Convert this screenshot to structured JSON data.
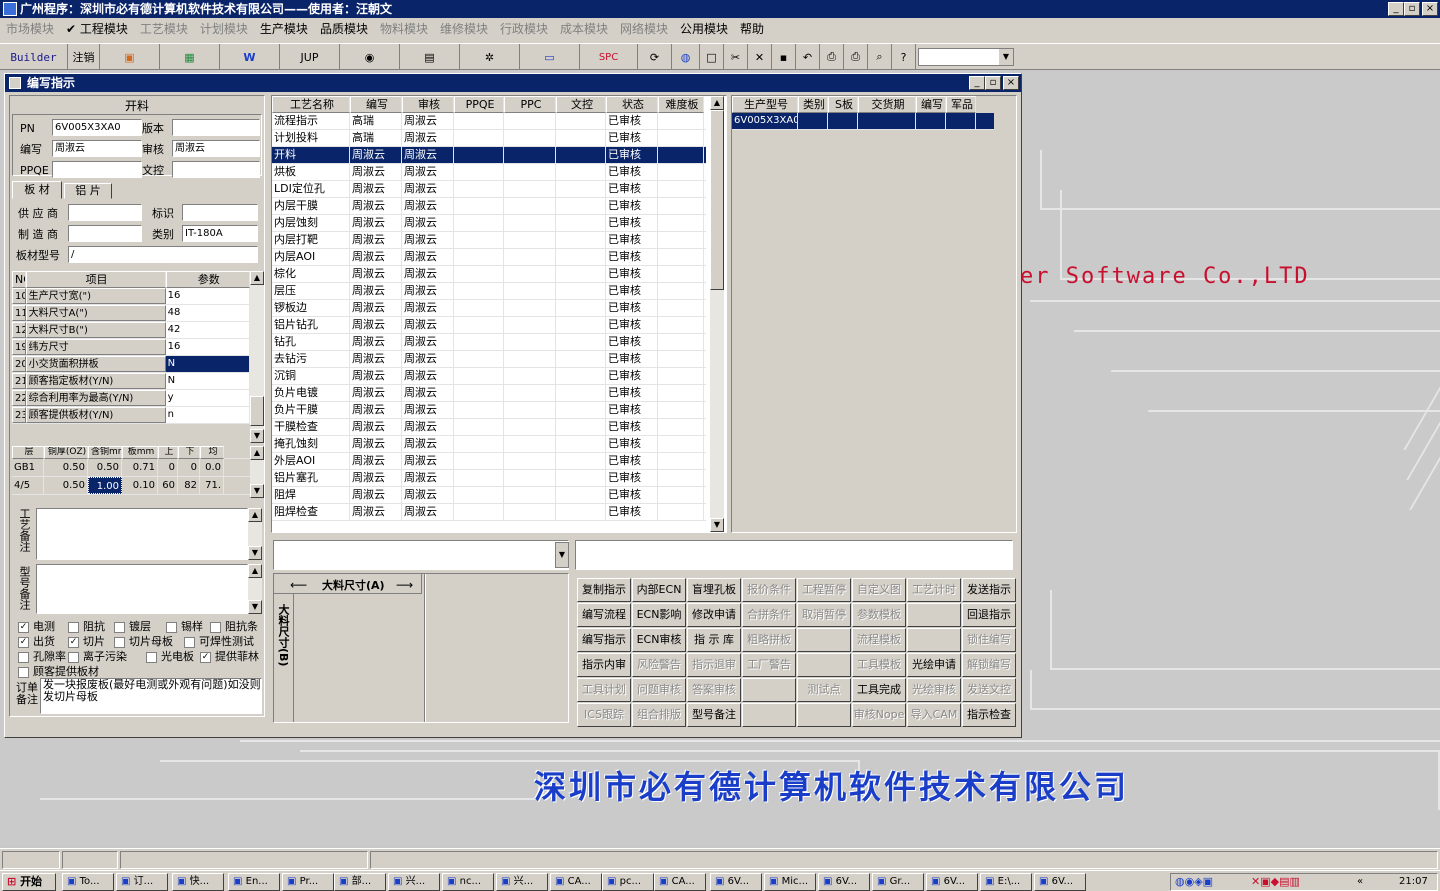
{
  "app": {
    "title": "广州程序：深圳市必有德计算机软件技术有限公司——使用者：汪朝文",
    "min": "_",
    "max": "▫",
    "close": "×"
  },
  "menu": [
    {
      "label": "市场模块",
      "dis": true
    },
    {
      "label": "✔ 工程模块",
      "dis": false
    },
    {
      "label": "工艺模块",
      "dis": true
    },
    {
      "label": "计划模块",
      "dis": true
    },
    {
      "label": "生产模块",
      "dis": false
    },
    {
      "label": "品质模块",
      "dis": false
    },
    {
      "label": "物料模块",
      "dis": true
    },
    {
      "label": "维修模块",
      "dis": true
    },
    {
      "label": "行政模块",
      "dis": true
    },
    {
      "label": "成本模块",
      "dis": true
    },
    {
      "label": "网络模块",
      "dis": true
    },
    {
      "label": "公用模块",
      "dis": false
    },
    {
      "label": "帮助",
      "dis": false
    }
  ],
  "toolbar": {
    "builder": "Builder",
    "logout": "注销",
    "jup": "JUP",
    "spc": "SPC",
    "combo": ""
  },
  "background": {
    "watermark": "er Software Co.,LTD",
    "company": "深圳市必有德计算机软件技术有限公司"
  },
  "window": {
    "title": "编写指示"
  },
  "left": {
    "section": "开料",
    "pn_label": "PN",
    "pn": "6V005X3XA0",
    "version_label": "版本",
    "version": "",
    "author_label": "编写",
    "author": "周淑云",
    "review_label": "审核",
    "review": "周淑云",
    "ppqe_label": "PPQE",
    "ppqe": "",
    "doc_label": "文控",
    "doc": "",
    "tab1": "板 材",
    "tab2": "铝 片",
    "supplier_label": "供 应 商",
    "supplier": "",
    "mark_label": "标识",
    "mark": "",
    "maker_label": "制 造 商",
    "maker": "",
    "category_label": "类别",
    "category": "IT-180A",
    "model_label": "板材型号",
    "model": "/",
    "params_headers": [
      "NO",
      "项目",
      "参数"
    ],
    "params": [
      {
        "no": "10",
        "item": "生产尺寸宽(\")",
        "val": "16"
      },
      {
        "no": "11",
        "item": "大料尺寸A(\")",
        "val": "48"
      },
      {
        "no": "12",
        "item": "大料尺寸B(\")",
        "val": "42"
      },
      {
        "no": "19",
        "item": "纬方尺寸",
        "val": "16"
      },
      {
        "no": "20",
        "item": "小交货面积拼板",
        "val": "N"
      },
      {
        "no": "21",
        "item": "顾客指定板材(Y/N)",
        "val": "N"
      },
      {
        "no": "22",
        "item": "综合利用率为最高(Y/N)",
        "val": "y"
      },
      {
        "no": "23",
        "item": "顾客提供板材(Y/N)",
        "val": "n"
      }
    ],
    "layer_headers": [
      "层",
      "铜厚(OZ)",
      "含铜mm",
      "板mm",
      "上",
      "下",
      "均"
    ],
    "layers": [
      {
        "l": "GB1",
        "a": "0.50",
        "b": "0.50",
        "c": "0.71",
        "d": "0",
        "e": "0",
        "f": "0.0"
      },
      {
        "l": "4/5",
        "a": "0.50",
        "b": "1.00",
        "c": "0.10",
        "d": "60",
        "e": "82",
        "f": "71."
      }
    ],
    "process_note_label": "工艺备注",
    "model_note_label": "型号备注",
    "checks": [
      {
        "label": "电测",
        "on": true
      },
      {
        "label": "阻抗",
        "on": false
      },
      {
        "label": "镀层",
        "on": false
      },
      {
        "label": "锡样",
        "on": false
      },
      {
        "label": "阻抗条",
        "on": false
      },
      {
        "label": "出货",
        "on": true
      },
      {
        "label": "切片",
        "on": true
      },
      {
        "label": "切片母板",
        "on": false
      },
      {
        "label": "可焊性测试",
        "on": false
      },
      {
        "label": "孔隙率",
        "on": false
      },
      {
        "label": "离子污染",
        "on": false
      },
      {
        "label": "光电板",
        "on": false
      },
      {
        "label": "提供菲林",
        "on": true
      },
      {
        "label": "顾客提供板材",
        "on": false
      }
    ],
    "order_note_label": "订单备注",
    "order_note": "发一块报废板(最好电测或外观有问题)如没则发切片母板"
  },
  "process": {
    "headers": [
      "工艺名称",
      "编写",
      "审核",
      "PPQE",
      "PPC",
      "文控",
      "状态",
      "难度板"
    ],
    "rows": [
      [
        "流程指示",
        "高瑞",
        "周淑云",
        "",
        "",
        "",
        "已审核",
        ""
      ],
      [
        "计划投料",
        "高瑞",
        "周淑云",
        "",
        "",
        "",
        "已审核",
        ""
      ],
      [
        "开料",
        "周淑云",
        "周淑云",
        "",
        "",
        "",
        "已审核",
        ""
      ],
      [
        "烘板",
        "周淑云",
        "周淑云",
        "",
        "",
        "",
        "已审核",
        ""
      ],
      [
        "LDI定位孔",
        "周淑云",
        "周淑云",
        "",
        "",
        "",
        "已审核",
        ""
      ],
      [
        "内层干膜",
        "周淑云",
        "周淑云",
        "",
        "",
        "",
        "已审核",
        ""
      ],
      [
        "内层蚀刻",
        "周淑云",
        "周淑云",
        "",
        "",
        "",
        "已审核",
        ""
      ],
      [
        "内层打靶",
        "周淑云",
        "周淑云",
        "",
        "",
        "",
        "已审核",
        ""
      ],
      [
        "内层AOI",
        "周淑云",
        "周淑云",
        "",
        "",
        "",
        "已审核",
        ""
      ],
      [
        "棕化",
        "周淑云",
        "周淑云",
        "",
        "",
        "",
        "已审核",
        ""
      ],
      [
        "层压",
        "周淑云",
        "周淑云",
        "",
        "",
        "",
        "已审核",
        ""
      ],
      [
        "锣板边",
        "周淑云",
        "周淑云",
        "",
        "",
        "",
        "已审核",
        ""
      ],
      [
        "铝片钻孔",
        "周淑云",
        "周淑云",
        "",
        "",
        "",
        "已审核",
        ""
      ],
      [
        "钻孔",
        "周淑云",
        "周淑云",
        "",
        "",
        "",
        "已审核",
        ""
      ],
      [
        "去钻污",
        "周淑云",
        "周淑云",
        "",
        "",
        "",
        "已审核",
        ""
      ],
      [
        "沉铜",
        "周淑云",
        "周淑云",
        "",
        "",
        "",
        "已审核",
        ""
      ],
      [
        "负片电镀",
        "周淑云",
        "周淑云",
        "",
        "",
        "",
        "已审核",
        ""
      ],
      [
        "负片干膜",
        "周淑云",
        "周淑云",
        "",
        "",
        "",
        "已审核",
        ""
      ],
      [
        "干膜检查",
        "周淑云",
        "周淑云",
        "",
        "",
        "",
        "已审核",
        ""
      ],
      [
        "掩孔蚀刻",
        "周淑云",
        "周淑云",
        "",
        "",
        "",
        "已审核",
        ""
      ],
      [
        "外层AOI",
        "周淑云",
        "周淑云",
        "",
        "",
        "",
        "已审核",
        ""
      ],
      [
        "铝片塞孔",
        "周淑云",
        "周淑云",
        "",
        "",
        "",
        "已审核",
        ""
      ],
      [
        "阻焊",
        "周淑云",
        "周淑云",
        "",
        "",
        "",
        "已审核",
        ""
      ],
      [
        "阻焊检查",
        "周淑云",
        "周淑云",
        "",
        "",
        "",
        "已审核",
        ""
      ]
    ]
  },
  "products": {
    "headers": [
      "生产型号",
      "类别",
      "S板",
      "交货期",
      "编写",
      "军品"
    ],
    "rows": [
      [
        "6V005X3XA0",
        "",
        "",
        "",
        "",
        ""
      ]
    ]
  },
  "dims": {
    "a_label": "大料尺寸(A)",
    "b_label": "大料尺寸(B)"
  },
  "buttons": [
    [
      {
        "t": "复制指示",
        "d": false
      },
      {
        "t": "内部ECN",
        "d": false
      },
      {
        "t": "盲埋孔板",
        "d": false
      },
      {
        "t": "报价条件",
        "d": true
      },
      {
        "t": "工程暂停",
        "d": true
      },
      {
        "t": "自定义图",
        "d": true
      },
      {
        "t": "工艺计时",
        "d": true
      },
      {
        "t": "发送指示",
        "d": false
      }
    ],
    [
      {
        "t": "编写流程",
        "d": false
      },
      {
        "t": "ECN影响",
        "d": false
      },
      {
        "t": "修改申请",
        "d": false
      },
      {
        "t": "合拼条件",
        "d": true
      },
      {
        "t": "取消暂停",
        "d": true
      },
      {
        "t": "参数模板",
        "d": true
      },
      {
        "t": "",
        "d": true
      },
      {
        "t": "回退指示",
        "d": false
      }
    ],
    [
      {
        "t": "编写指示",
        "d": false
      },
      {
        "t": "ECN审核",
        "d": false
      },
      {
        "t": "指 示 库",
        "d": false
      },
      {
        "t": "粗略拼板",
        "d": true
      },
      {
        "t": "",
        "d": true
      },
      {
        "t": "流程模板",
        "d": true
      },
      {
        "t": "",
        "d": true
      },
      {
        "t": "锁住编写",
        "d": true
      }
    ],
    [
      {
        "t": "指示内审",
        "d": false
      },
      {
        "t": "风险警告",
        "d": true
      },
      {
        "t": "指示退审",
        "d": true
      },
      {
        "t": "工厂警告",
        "d": true
      },
      {
        "t": "",
        "d": true
      },
      {
        "t": "工具模板",
        "d": true
      },
      {
        "t": "光绘申请",
        "d": false
      },
      {
        "t": "解锁编写",
        "d": true
      }
    ],
    [
      {
        "t": "工具计划",
        "d": true
      },
      {
        "t": "问题审核",
        "d": true
      },
      {
        "t": "答案审核",
        "d": true
      },
      {
        "t": "",
        "d": true
      },
      {
        "t": "测试点",
        "d": true
      },
      {
        "t": "工具完成",
        "d": false
      },
      {
        "t": "光绘审核",
        "d": true
      },
      {
        "t": "发送文控",
        "d": true
      }
    ],
    [
      {
        "t": "ICS跟踪",
        "d": true
      },
      {
        "t": "组合排版",
        "d": true
      },
      {
        "t": "型号备注",
        "d": false
      },
      {
        "t": "",
        "d": true
      },
      {
        "t": "",
        "d": true
      },
      {
        "t": "审核Nope",
        "d": true
      },
      {
        "t": "导入CAM",
        "d": true
      },
      {
        "t": "指示检查",
        "d": false
      }
    ]
  ],
  "taskbar": {
    "start": "开始",
    "clock": "21:07",
    "tasks": [
      "To...",
      "订...",
      "快...",
      "En...",
      "Pr...",
      "部...",
      "兴...",
      "nc...",
      "兴...",
      "CA...",
      "pc...",
      "CA...",
      "6V...",
      "Mic...",
      "6V...",
      "Gr...",
      "6V...",
      "E:\\...",
      "6V..."
    ]
  }
}
